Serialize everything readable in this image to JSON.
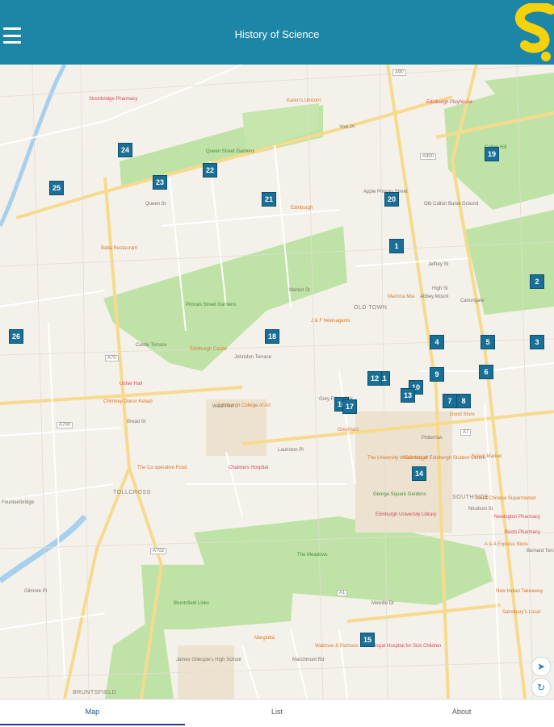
{
  "header": {
    "title": "History of Science",
    "menu_icon": "hamburger-menu-icon",
    "logo": "s-logo"
  },
  "map": {
    "labels": [
      {
        "text": "Stockbridge Pharmacy",
        "kind": "red"
      },
      {
        "text": "Queen Street Gardens",
        "kind": "green"
      },
      {
        "text": "Karen's Unicorn",
        "kind": "poi"
      },
      {
        "text": "Edinburgh Playhouse",
        "kind": "red"
      },
      {
        "text": "Calton Hill",
        "kind": "green"
      },
      {
        "text": "Edinburgh",
        "kind": "poi"
      },
      {
        "text": "Apple Princes Street",
        "kind": "plain"
      },
      {
        "text": "Old Calton Burial Ground",
        "kind": "plain"
      },
      {
        "text": "Baba Restaurant",
        "kind": "poi"
      },
      {
        "text": "Jeffrey St",
        "kind": "plain"
      },
      {
        "text": "High St",
        "kind": "plain"
      },
      {
        "text": "Mamma Mia",
        "kind": "poi"
      },
      {
        "text": "OLD TOWN",
        "kind": "area"
      },
      {
        "text": "Princes Street Gardens",
        "kind": "green"
      },
      {
        "text": "J & F Newsagents",
        "kind": "poi"
      },
      {
        "text": "Edinburgh Castle",
        "kind": "poi"
      },
      {
        "text": "Usher Hall",
        "kind": "red"
      },
      {
        "text": "Chimney Donor Kebab",
        "kind": "poi"
      },
      {
        "text": "Edinburgh College of Art",
        "kind": "poi"
      },
      {
        "text": "Chalmers Hospital",
        "kind": "red"
      },
      {
        "text": "The Co operative Food",
        "kind": "poi"
      },
      {
        "text": "TOLLCROSS",
        "kind": "area"
      },
      {
        "text": "The University of Edinburgh",
        "kind": "poi"
      },
      {
        "text": "University of Edinburgh Student Centre",
        "kind": "poi"
      },
      {
        "text": "George Square Gardens",
        "kind": "green"
      },
      {
        "text": "Edinburgh University Library",
        "kind": "red"
      },
      {
        "text": "SOUTHSIDE",
        "kind": "area"
      },
      {
        "text": "Grey Friars Kirk",
        "kind": "plain"
      },
      {
        "text": "Greyfriars",
        "kind": "poi"
      },
      {
        "text": "Good Store",
        "kind": "poi"
      },
      {
        "text": "Scoop Market",
        "kind": "poi"
      },
      {
        "text": "Krisa Chinese Supermarket",
        "kind": "poi"
      },
      {
        "text": "Newington Pharmacy",
        "kind": "red"
      },
      {
        "text": "A & A Express Store",
        "kind": "poi"
      },
      {
        "text": "Boots Pharmacy",
        "kind": "red"
      },
      {
        "text": "The Meadows",
        "kind": "green"
      },
      {
        "text": "Bruntsfield Links",
        "kind": "green"
      },
      {
        "text": "Margiotta",
        "kind": "poi"
      },
      {
        "text": "Waitrose & Partners",
        "kind": "poi"
      },
      {
        "text": "Royal Hospital for Sick Children",
        "kind": "red"
      },
      {
        "text": "James Gillespie's High School",
        "kind": "plain"
      },
      {
        "text": "BRUNTSFIELD",
        "kind": "area"
      },
      {
        "text": "New Indian Takeaway",
        "kind": "poi"
      },
      {
        "text": "Sainsbury's Local",
        "kind": "poi"
      },
      {
        "text": "Fountainbridge",
        "kind": "plain"
      },
      {
        "text": "Lauriston Pl",
        "kind": "plain"
      },
      {
        "text": "West Port",
        "kind": "plain"
      },
      {
        "text": "Bread St",
        "kind": "plain"
      },
      {
        "text": "Market St",
        "kind": "plain"
      },
      {
        "text": "Johnston Terrace",
        "kind": "plain"
      },
      {
        "text": "Castle Terrace",
        "kind": "plain"
      },
      {
        "text": "York Pl",
        "kind": "plain"
      },
      {
        "text": "Queen St",
        "kind": "plain"
      },
      {
        "text": "Melville Dr",
        "kind": "plain"
      },
      {
        "text": "Potterrow",
        "kind": "plain"
      },
      {
        "text": "Nicolson St",
        "kind": "plain"
      },
      {
        "text": "Bernard Terrace",
        "kind": "plain"
      },
      {
        "text": "Marchmont Rd",
        "kind": "plain"
      },
      {
        "text": "Gilmore Pl",
        "kind": "plain"
      },
      {
        "text": "Abbey Mount",
        "kind": "plain"
      },
      {
        "text": "Canongate",
        "kind": "plain"
      }
    ],
    "markers": [
      "1",
      "2",
      "3",
      "4",
      "5",
      "6",
      "7",
      "8",
      "9",
      "10",
      "11",
      "12",
      "13",
      "14",
      "15",
      "16",
      "17",
      "19",
      "20",
      "21",
      "22",
      "23",
      "24",
      "25",
      "26",
      "18"
    ],
    "road_labels": [
      "A90",
      "A900",
      "A70",
      "A700",
      "A702",
      "A1",
      "A7"
    ],
    "controls": {
      "locate_icon": "location-arrow-icon",
      "refresh_icon": "refresh-icon"
    }
  },
  "tabs": [
    {
      "label": "Map",
      "active": true
    },
    {
      "label": "List",
      "active": false
    },
    {
      "label": "About",
      "active": false
    }
  ],
  "colors": {
    "header": "#1d86a6",
    "marker": "#1a6f96",
    "park": "#bfe3a6",
    "logo": "#f4d20c"
  }
}
